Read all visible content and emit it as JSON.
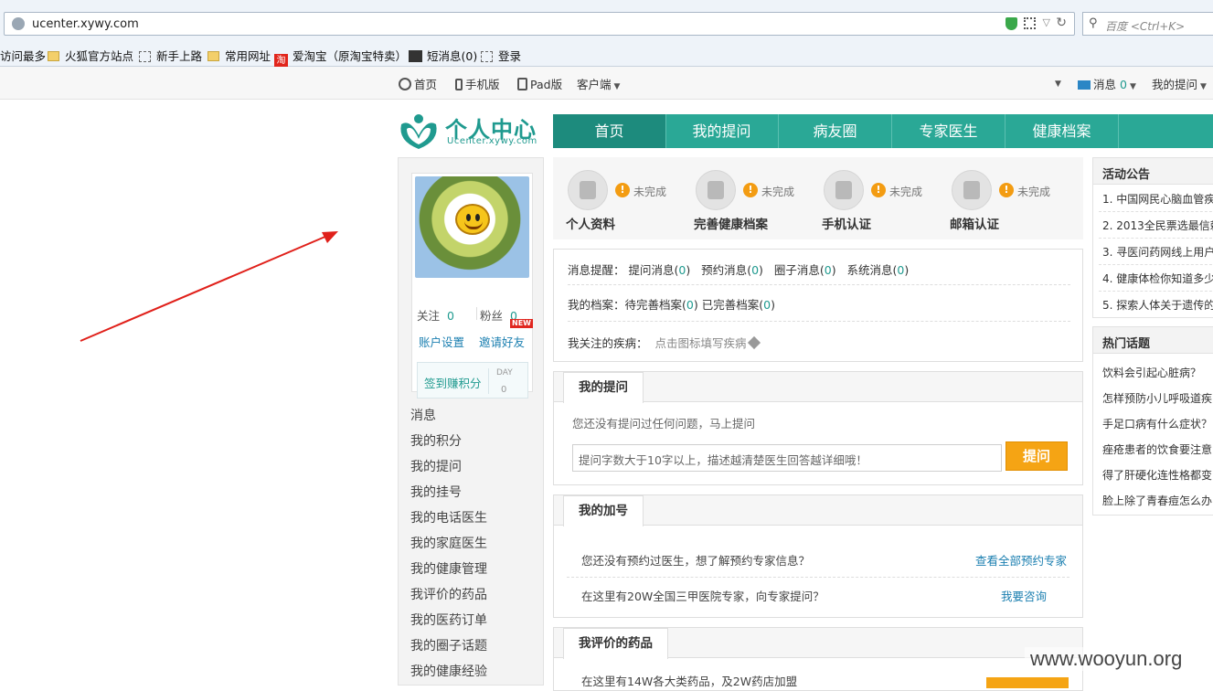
{
  "browser": {
    "url": "ucenter.xywy.com",
    "search_placeholder": "百度 <Ctrl+K>",
    "bookmarks": [
      "访问最多",
      "火狐官方站点",
      "新手上路",
      "常用网址",
      "爱淘宝（原淘宝特卖）",
      "短消息(0)",
      "登录"
    ],
    "taobao_glyph": "淘"
  },
  "topbar": {
    "home": "首页",
    "mobile": "手机版",
    "pad": "Pad版",
    "client": "客户端",
    "messages_label": "消息",
    "messages_count": "0",
    "my_questions": "我的提问"
  },
  "logo": {
    "title": "个人中心",
    "subtitle": "Ucenter.xywy.com"
  },
  "nav": [
    "首页",
    "我的提问",
    "病友圈",
    "专家医生",
    "健康档案"
  ],
  "profile": {
    "follow_label": "关注",
    "follow_count": "0",
    "fans_label": "粉丝",
    "fans_count": "0",
    "new_badge": "NEW",
    "account_settings": "账户设置",
    "invite": "邀请好友",
    "sign_in": "签到赚积分",
    "day_label": "DAY",
    "day_value": "0"
  },
  "sidebar_menu": [
    "消息",
    "我的积分",
    "我的提问",
    "我的挂号",
    "我的电话医生",
    "我的家庭医生",
    "我的健康管理",
    "我评价的药品",
    "我的医药订单",
    "我的圈子话题",
    "我的健康经验"
  ],
  "tasks": [
    {
      "name": "个人资料",
      "status": "未完成",
      "icon": "person-icon"
    },
    {
      "name": "完善健康档案",
      "status": "未完成",
      "icon": "record-book-icon"
    },
    {
      "name": "手机认证",
      "status": "未完成",
      "icon": "mobile-signal-icon"
    },
    {
      "name": "邮箱认证",
      "status": "未完成",
      "icon": "mail-icon"
    }
  ],
  "notices": {
    "reminder_label": "消息提醒：",
    "reminders": [
      {
        "label": "提问消息",
        "count": "0"
      },
      {
        "label": "预约消息",
        "count": "0"
      },
      {
        "label": "圈子消息",
        "count": "0"
      },
      {
        "label": "系统消息",
        "count": "0"
      }
    ],
    "archive_label": "我的档案：",
    "archive_pending": "待完善档案",
    "archive_pending_count": "0",
    "archive_done": "已完善档案",
    "archive_done_count": "0",
    "disease_label": "我关注的疾病：",
    "disease_hint": "点击图标填写疾病"
  },
  "ask": {
    "tab": "我的提问",
    "hint": "您还没有提问过任何问题，马上提问",
    "placeholder": "提问字数大于10字以上，描述越清楚医生回答越详细哦！",
    "button": "提问"
  },
  "appointment": {
    "tab": "我的加号",
    "row1": "您还没有预约过医生，想了解预约专家信息？",
    "row1_link": "查看全部预约专家",
    "row2": "在这里有20W全国三甲医院专家，向专家提问？",
    "row2_link": "我要咨询"
  },
  "drugs": {
    "tab": "我评价的药品",
    "row1": "在这里有14W各大类药品，及2W药店加盟"
  },
  "announcements": {
    "title": "活动公告",
    "items": [
      "1. 中国网民心脑血管疾",
      "2. 2013全民票选最信赖",
      "3. 寻医问药网线上用户",
      "4. 健康体检你知道多少",
      "5. 探索人体关于遗传的"
    ]
  },
  "hot_topics": {
    "title": "热门话题",
    "items": [
      "饮料会引起心脏病？",
      "怎样预防小儿呼吸道疾",
      "手足口病有什么症状？",
      "痤疮患者的饮食要注意",
      "得了肝硬化连性格都变",
      "脸上除了青春痘怎么办"
    ]
  },
  "watermark": "www.wooyun.org",
  "colors": {
    "brand": "#2aa896",
    "nav_active": "#1d8b7d",
    "accent": "#f5a414",
    "link": "#1b7fb0",
    "annotation_arrow": "#e0201a"
  }
}
